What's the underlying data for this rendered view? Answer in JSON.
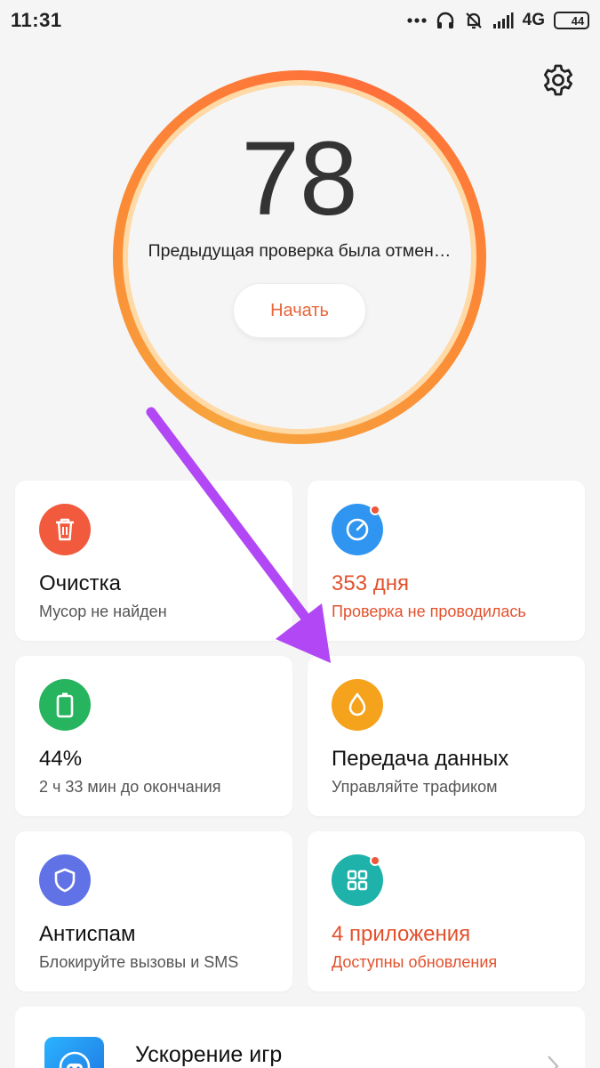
{
  "status_bar": {
    "time": "11:31",
    "network": "4G",
    "battery_level": "44",
    "battery_fraction": 0.44,
    "icons": [
      "more-dots-icon",
      "headphones-icon",
      "muted-bell-icon",
      "signal-icon",
      "network-4g-icon",
      "battery-icon"
    ]
  },
  "header": {
    "settings_icon": "gear-icon"
  },
  "score": {
    "value": "78",
    "subtitle": "Предыдущая проверка была отмен…",
    "start_label": "Начать",
    "ring_colors": [
      "#f7a53e",
      "#ff6f3a"
    ]
  },
  "cards": [
    {
      "id": "cleanup",
      "icon": "trash-icon",
      "icon_color": "#f15a3c",
      "title": "Очистка",
      "subtitle": "Мусор не найден",
      "alert": false,
      "badge": false
    },
    {
      "id": "security-scan",
      "icon": "speedometer-icon",
      "icon_color": "#2f95f0",
      "title": "353 дня",
      "subtitle": "Проверка не проводилась",
      "alert": true,
      "badge": true
    },
    {
      "id": "battery",
      "icon": "battery-icon",
      "icon_color": "#27b45e",
      "title": "44%",
      "subtitle": "2 ч 33 мин до окончания",
      "alert": false,
      "badge": false
    },
    {
      "id": "data-usage",
      "icon": "water-drop-icon",
      "icon_color": "#f5a21c",
      "title": "Передача данных",
      "subtitle": "Управляйте трафиком",
      "alert": false,
      "badge": false
    },
    {
      "id": "antispam",
      "icon": "shield-icon",
      "icon_color": "#6072e6",
      "title": "Антиспам",
      "subtitle": "Блокируйте вызовы и SMS",
      "alert": false,
      "badge": false
    },
    {
      "id": "app-updates",
      "icon": "grid-apps-icon",
      "icon_color": "#1fb2aa",
      "title": "4 приложения",
      "subtitle": "Доступны обновления",
      "alert": true,
      "badge": true
    }
  ],
  "game_booster": {
    "title": "Ускорение игр",
    "icon": "gamepad-icon"
  },
  "annotation": {
    "arrow_color": "#b147f5",
    "icon": "pointer-arrow-icon"
  }
}
